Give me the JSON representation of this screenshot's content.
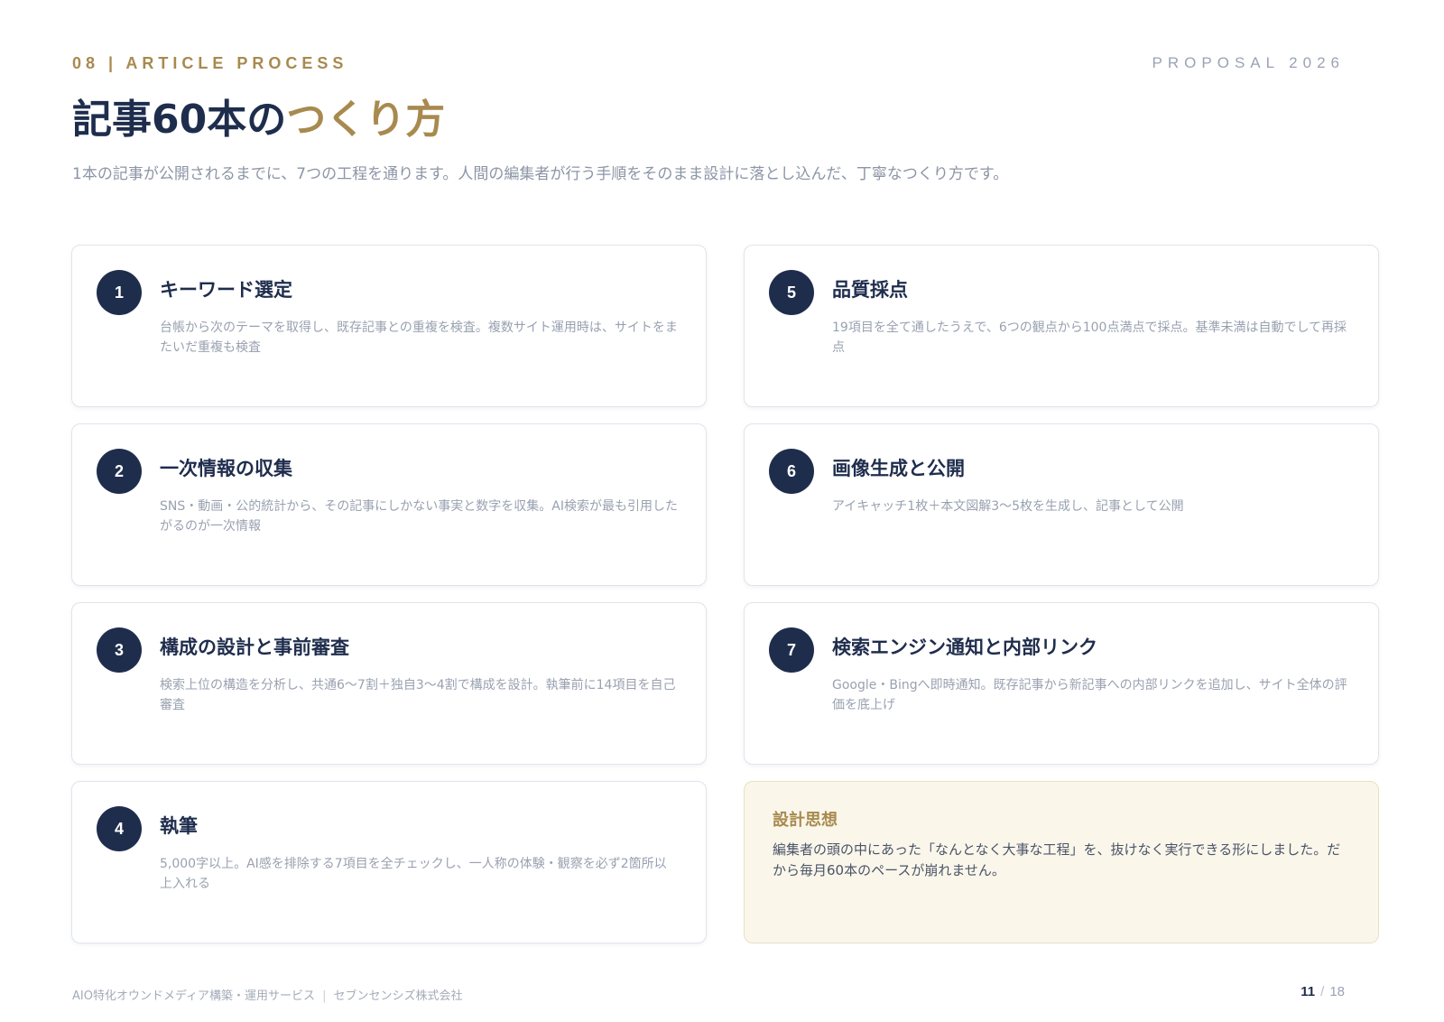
{
  "header": {
    "section_label": "08 | ARTICLE PROCESS",
    "proposal_label": "PROPOSAL 2026",
    "title_main": "記事60本の",
    "title_accent": "つくり方",
    "subtitle": "1本の記事が公開されるまでに、7つの工程を通ります。人間の編集者が行う手順をそのまま設計に落とし込んだ、丁寧なつくり方です。"
  },
  "steps": [
    {
      "num": "1",
      "title": "キーワード選定",
      "desc": "台帳から次のテーマを取得し、既存記事との重複を検査。複数サイト運用時は、サイトをまたいだ重複も検査"
    },
    {
      "num": "2",
      "title": "一次情報の収集",
      "desc": "SNS・動画・公的統計から、その記事にしかない事実と数字を収集。AI検索が最も引用したがるのが一次情報"
    },
    {
      "num": "3",
      "title": "構成の設計と事前審査",
      "desc": "検索上位の構造を分析し、共通6〜7割＋独自3〜4割で構成を設計。執筆前に14項目を自己審査"
    },
    {
      "num": "4",
      "title": "執筆",
      "desc": "5,000字以上。AI感を排除する7項目を全チェックし、一人称の体験・観察を必ず2箇所以上入れる"
    },
    {
      "num": "5",
      "title": "品質採点",
      "desc": "19項目を全て通したうえで、6つの観点から100点満点で採点。基準未満は自動でして再採点"
    },
    {
      "num": "6",
      "title": "画像生成と公開",
      "desc": "アイキャッチ1枚＋本文図解3〜5枚を生成し、記事として公開"
    },
    {
      "num": "7",
      "title": "検索エンジン通知と内部リンク",
      "desc": "Google・Bingへ即時通知。既存記事から新記事への内部リンクを追加し、サイト全体の評価を底上げ"
    }
  ],
  "philosophy": {
    "title": "設計思想",
    "text": "編集者の頭の中にあった「なんとなく大事な工程」を、抜けなく実行できる形にしました。だから毎月60本のペースが崩れません。"
  },
  "footer": {
    "service": "AIO特化オウンドメディア構築・運用サービス",
    "separator": "|",
    "company": "セブンセンシズ株式会社",
    "page_current": "11",
    "page_slash": "/",
    "page_total": "18"
  }
}
